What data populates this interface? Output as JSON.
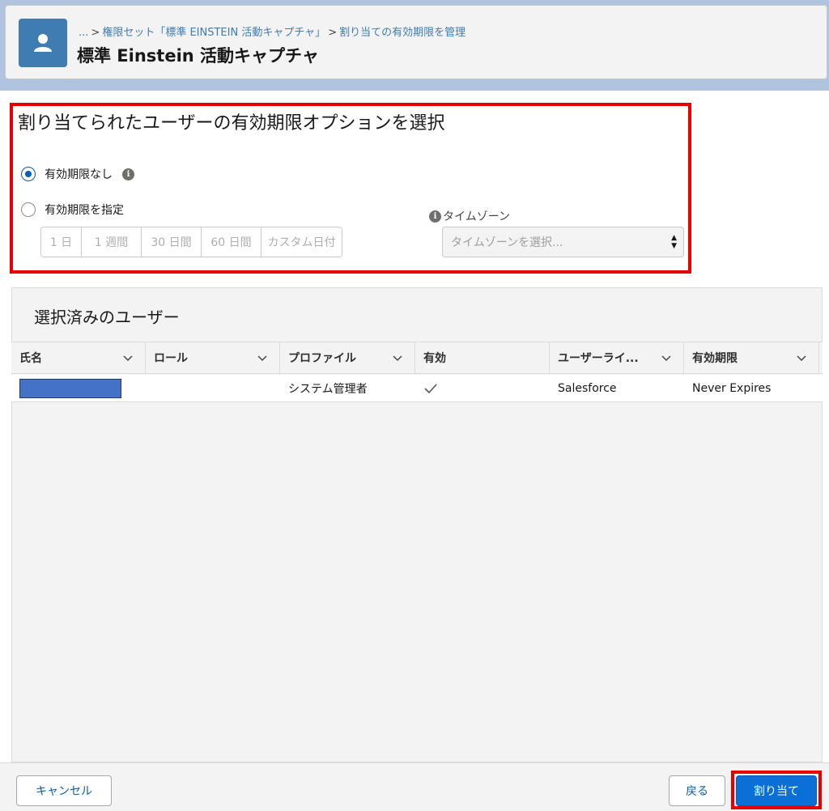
{
  "header": {
    "breadcrumb": {
      "ellipsis": "...",
      "crumb1": "権限セット「標準 EINSTEIN 活動キャプチャ」",
      "crumb2": "割り当ての有効期限を管理"
    },
    "title": "標準 Einstein 活動キャプチャ",
    "icon": "user-icon"
  },
  "expiration": {
    "section_title": "割り当てられたユーザーの有効期限オプションを選択",
    "options": [
      {
        "label": "有効期限なし",
        "selected": true
      },
      {
        "label": "有効期限を指定",
        "selected": false
      }
    ],
    "durations": [
      "1 日",
      "1 週間",
      "30 日間",
      "60 日間",
      "カスタム日付"
    ],
    "timezone": {
      "label": "タイムゾーン",
      "placeholder": "タイムゾーンを選択..."
    }
  },
  "users": {
    "title": "選択済みのユーザー",
    "columns": [
      "氏名",
      "ロール",
      "プロファイル",
      "有効",
      "ユーザーライ...",
      "有効期限"
    ],
    "rows": [
      {
        "name": "",
        "role": "",
        "profile": "システム管理者",
        "active": "✓",
        "license": "Salesforce",
        "expiration": "Never Expires"
      }
    ]
  },
  "footer": {
    "cancel": "キャンセル",
    "back": "戻る",
    "assign": "割り当て"
  },
  "colors": {
    "highlight": "#e60000",
    "brand": "#0b6fd8",
    "link": "#3e7cb1"
  }
}
